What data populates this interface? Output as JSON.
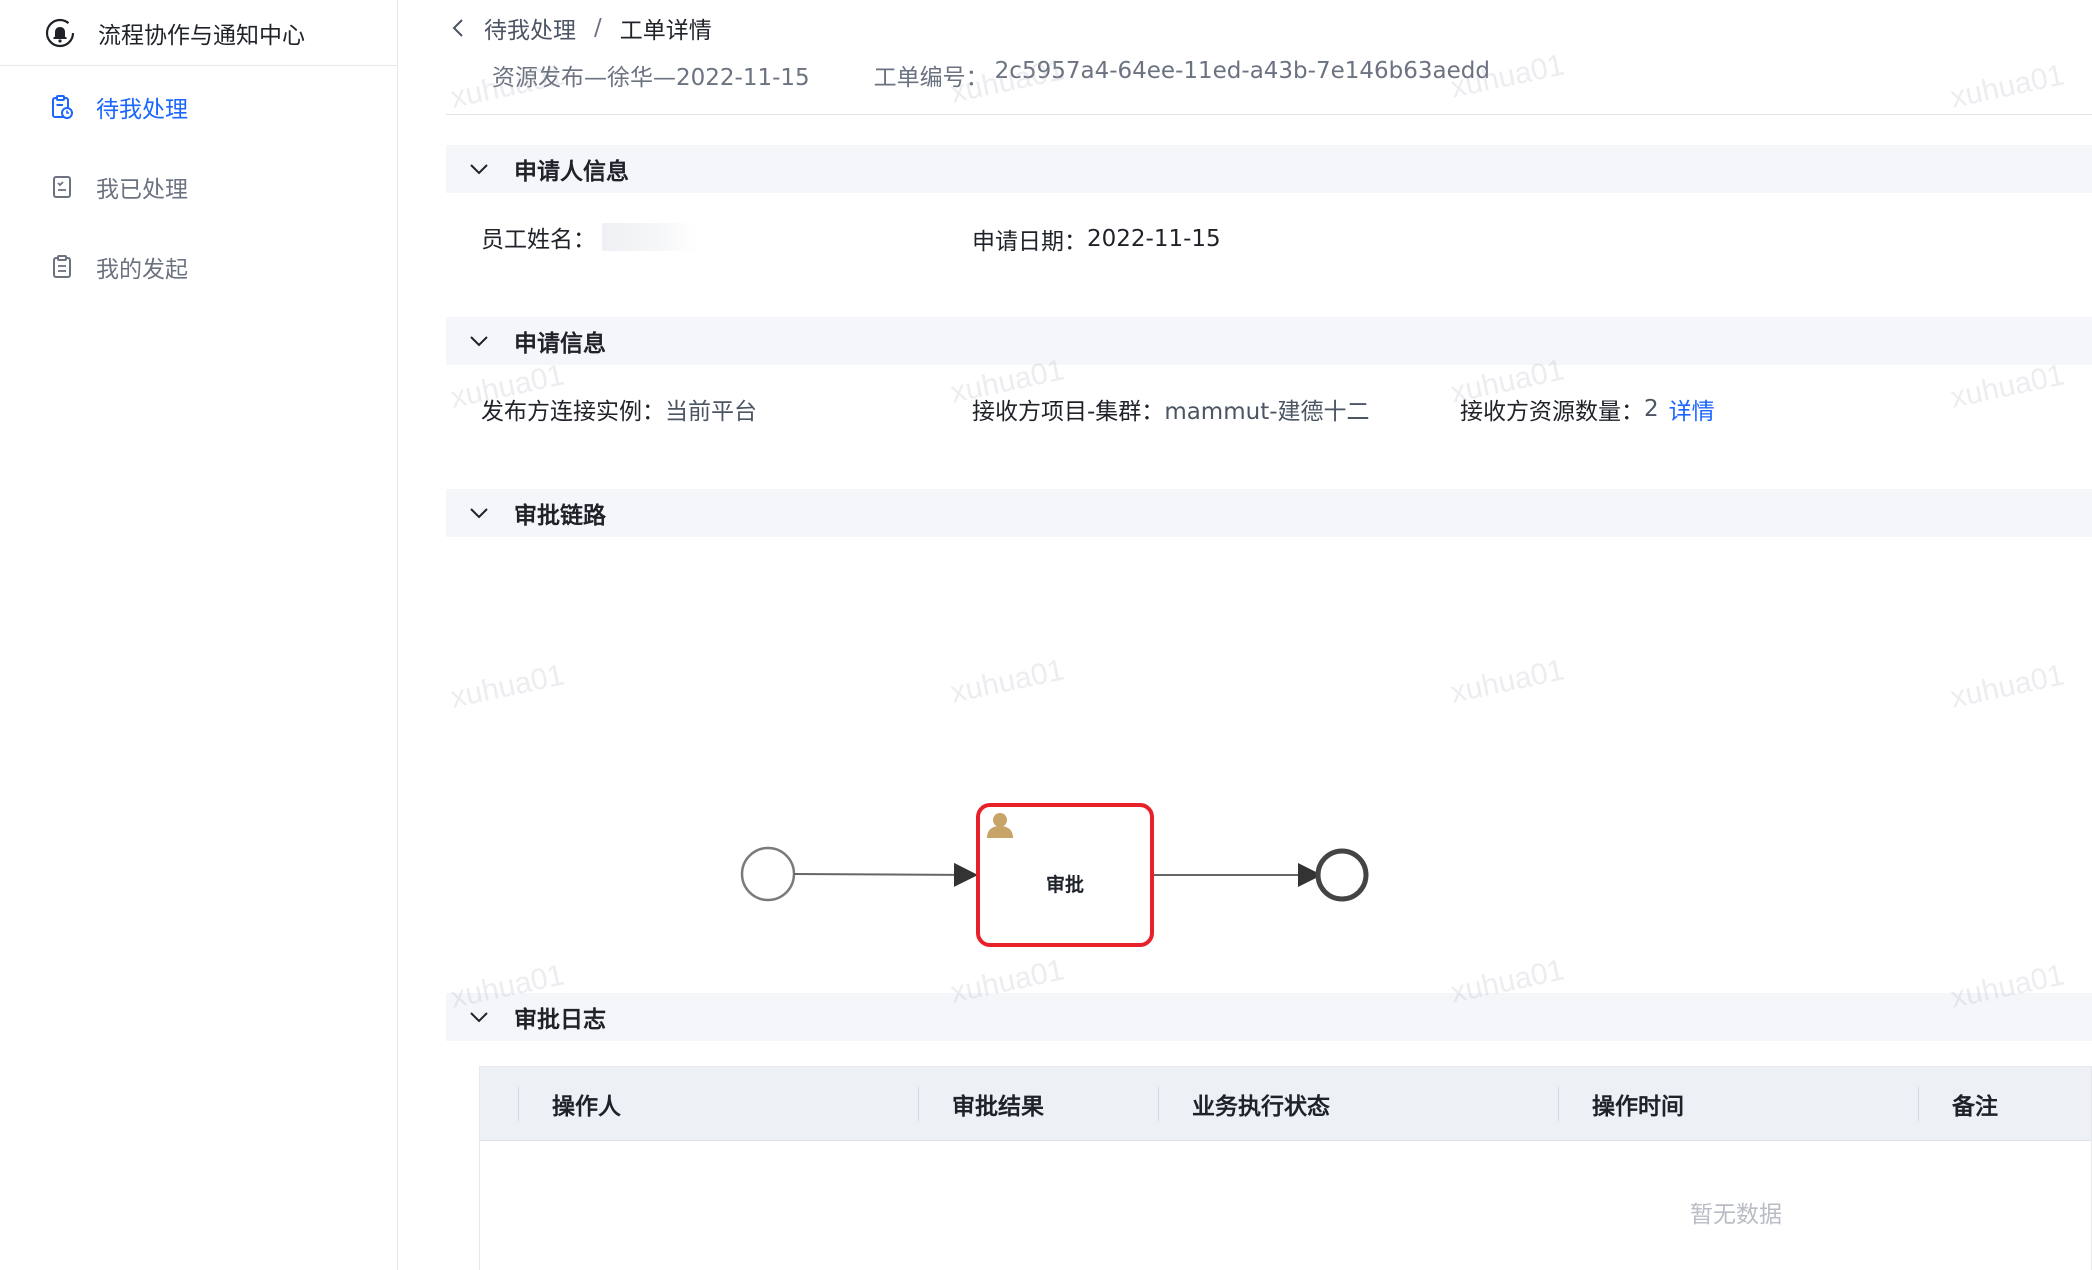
{
  "app": {
    "title": "流程协作与通知中心"
  },
  "sidebar": {
    "items": [
      {
        "label": "待我处理",
        "active": true
      },
      {
        "label": "我已处理",
        "active": false
      },
      {
        "label": "我的发起",
        "active": false
      }
    ]
  },
  "breadcrumb": {
    "parent": "待我处理",
    "separator": "/",
    "current": "工单详情"
  },
  "ticket": {
    "title": "资源发布—徐华—2022-11-15",
    "order_label": "工单编号：",
    "order_id": "2c5957a4-64ee-11ed-a43b-7e146b63aedd"
  },
  "sections": {
    "applicant": {
      "title": "申请人信息",
      "employee_name_label": "员工姓名：",
      "apply_date_label": "申请日期：",
      "apply_date": "2022-11-15"
    },
    "application": {
      "title": "申请信息",
      "publisher_label": "发布方连接实例：",
      "publisher_value": "当前平台",
      "receiver_project_label": "接收方项目-集群：",
      "receiver_project_value": "mammut-建德十二",
      "receiver_count_label": "接收方资源数量：",
      "receiver_count_value": "2",
      "detail_link": "详情"
    },
    "approval_chain": {
      "title": "审批链路",
      "task_label": "审批"
    },
    "approval_log": {
      "title": "审批日志",
      "columns": [
        "操作人",
        "审批结果",
        "业务执行状态",
        "操作时间",
        "备注"
      ],
      "empty_text": "暂无数据"
    }
  },
  "watermark": "xuhua01",
  "colors": {
    "accent": "#1a66ff",
    "task_border": "#e8202a",
    "user_icon": "#c9a468"
  }
}
